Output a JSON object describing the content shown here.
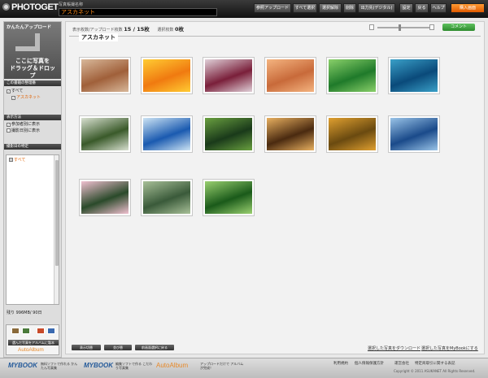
{
  "header": {
    "logo_text": "PHOTOGET",
    "album_label": "写真帳撮名称",
    "album_name": "アスカネット",
    "buttons": [
      "参照アップロード",
      "すべて選択",
      "選択解除",
      "削除",
      "出力先(デジタル)",
      "設定",
      "戻る",
      "ヘルプ",
      "購入画面"
    ]
  },
  "left_panel": {
    "easy_upload_title": "かんたんアップロード",
    "drop_line1": "ここに写真を",
    "drop_line2": "ドラッグ＆ドロップ",
    "section_album": "この書籍の整理番",
    "album_all": "すべて",
    "album_item": "アスカネット",
    "section_view": "表示方法",
    "view_opt1": "参加者別に表示",
    "view_opt2": "撮影日別に表示",
    "section_date": "撮影日の特定",
    "tree_item": "すべて",
    "remaining": "残り 996MB/ 90日",
    "autoalbum_button": "選んだ写真をアルバムに製本",
    "autoalbum_brand": "AutoAlbum"
  },
  "main": {
    "status_upload_label": "表示枚数/アップロード枚数",
    "status_upload_value": "15 / 15枚",
    "status_selected_label": "選択枚数",
    "status_selected_value": "0枚",
    "comment_button": "コメント",
    "tab_title": "アスカネット",
    "photos": [
      {
        "name": "canyon",
        "c1": "#a0603a",
        "c2": "#d8b89a"
      },
      {
        "name": "orange-flower",
        "c1": "#f07a10",
        "c2": "#ffcc33"
      },
      {
        "name": "frost-leaves",
        "c1": "#7a1f3a",
        "c2": "#e0d0d8"
      },
      {
        "name": "desert-dunes",
        "c1": "#c86a3a",
        "c2": "#f4b480"
      },
      {
        "name": "green-plant",
        "c1": "#1f7a2a",
        "c2": "#8ad06a"
      },
      {
        "name": "sea-turtle",
        "c1": "#0a4a7a",
        "c2": "#3aa0c8"
      },
      {
        "name": "waterfall",
        "c1": "#3a5a2a",
        "c2": "#d8e0d0"
      },
      {
        "name": "dock-water",
        "c1": "#1a5ab0",
        "c2": "#cde4f4"
      },
      {
        "name": "toucan",
        "c1": "#1a3a1a",
        "c2": "#6aa040"
      },
      {
        "name": "tree-sunset",
        "c1": "#4a2a10",
        "c2": "#e8b060"
      },
      {
        "name": "autumn-tree",
        "c1": "#6a4a10",
        "c2": "#e0a030"
      },
      {
        "name": "whale-tail",
        "c1": "#1a4a8a",
        "c2": "#9ac4e8"
      },
      {
        "name": "pink-flowers",
        "c1": "#2a4a2a",
        "c2": "#f0c0d0"
      },
      {
        "name": "stream",
        "c1": "#3a5a3a",
        "c2": "#a8c098"
      },
      {
        "name": "forest-path",
        "c1": "#1a5a1a",
        "c2": "#9ad070"
      }
    ]
  },
  "bottom": {
    "btn_view": "表示切替",
    "btn_sort": "並び替",
    "btn_back": "前画面選択に戻る",
    "link_download": "選択した写真をダウンロード",
    "link_mybook": "選択した写真をMyBookにする"
  },
  "footer": {
    "mybook1_logo": "MYBOOK",
    "mybook1_desc": "無料ソフトで作れる かんたん写真集",
    "mybook2_logo": "MYBOOK",
    "mybook2_desc": "編集ソフトで作る こだわり写真集",
    "autoalbum_logo": "AutoAlbum",
    "autoalbum_desc": "アップロードだけで アルバムが完成！",
    "links": [
      "利用規約",
      "個人情報保護方針",
      "運営会社",
      "特定商取引に関する表記"
    ],
    "copyright": "Copyright © 2011 ASUKANET All Rights Reserved."
  }
}
